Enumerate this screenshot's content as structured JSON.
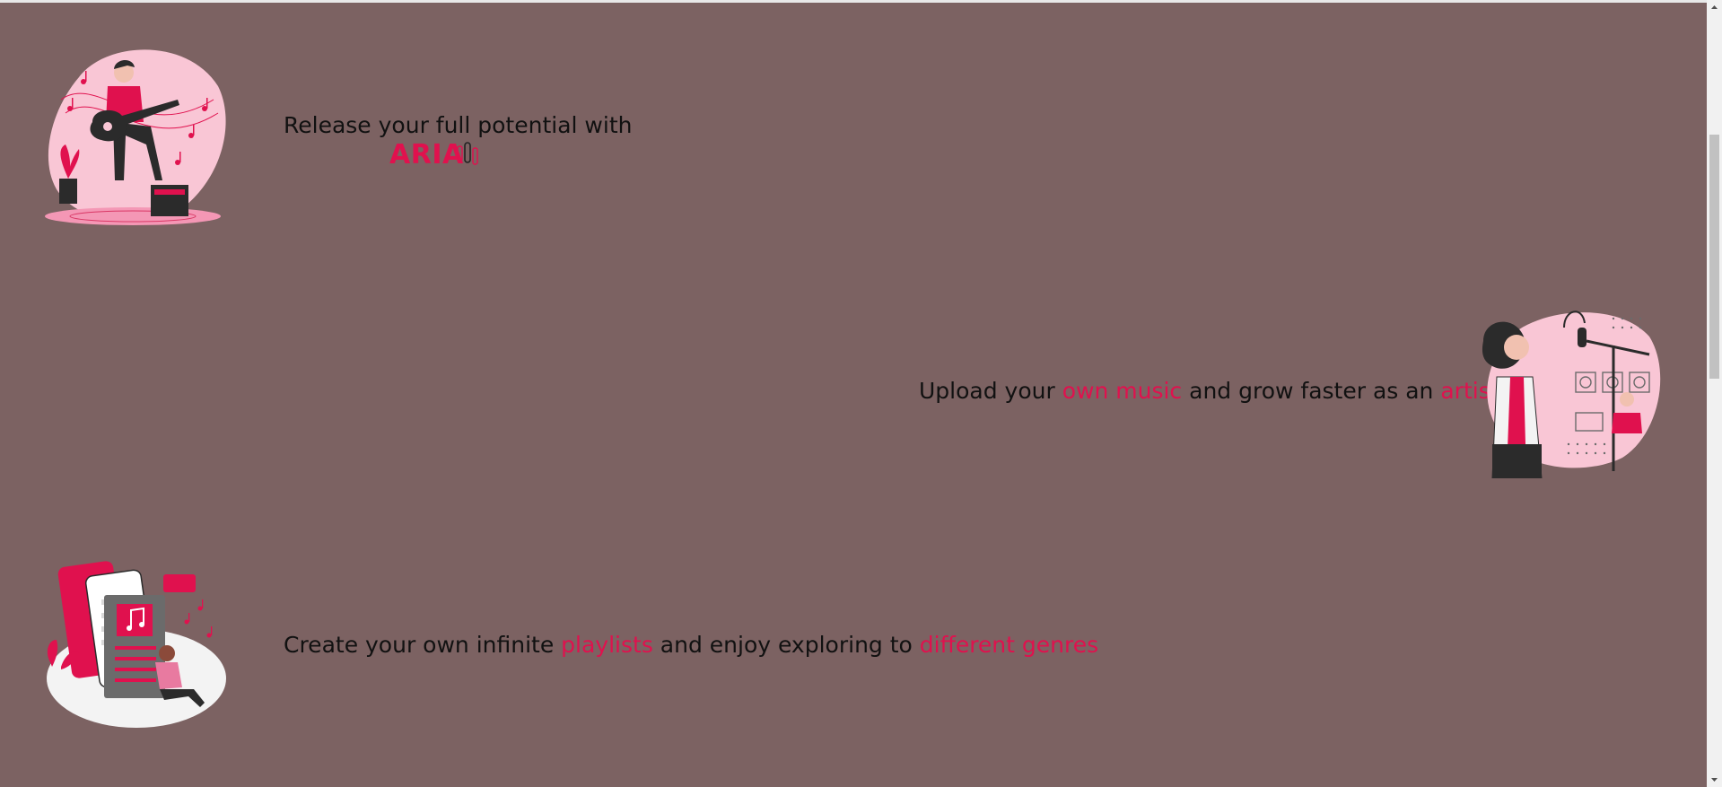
{
  "sections": [
    {
      "illustration": "guitarist-illustration",
      "text_parts": [
        {
          "text": "Release your full potential with",
          "accent": false
        }
      ],
      "brand": "ARIA"
    },
    {
      "illustration": "singer-microphone-illustration",
      "text_parts": [
        {
          "text": "Upload your ",
          "accent": false
        },
        {
          "text": "own music",
          "accent": true
        },
        {
          "text": " and grow faster as an ",
          "accent": false
        },
        {
          "text": "artist",
          "accent": true
        }
      ]
    },
    {
      "illustration": "playlist-phone-illustration",
      "text_parts": [
        {
          "text": "Create your own infinite ",
          "accent": false
        },
        {
          "text": "playlists",
          "accent": true
        },
        {
          "text": " and enjoy exploring to ",
          "accent": false
        },
        {
          "text": "different genres",
          "accent": true
        }
      ]
    }
  ],
  "colors": {
    "background": "#7c6262",
    "accent": "#e0114e",
    "text": "#111111",
    "blob": "#f9c6d5"
  }
}
